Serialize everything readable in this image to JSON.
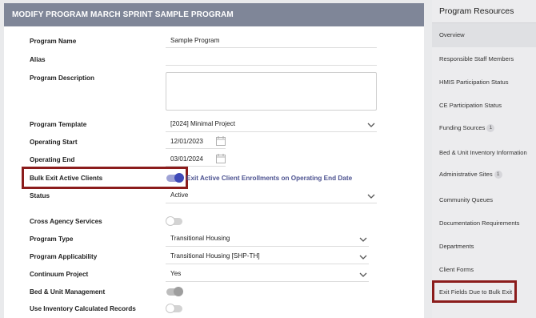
{
  "header": {
    "title": "MODIFY PROGRAM MARCH SPRINT SAMPLE PROGRAM"
  },
  "form": {
    "program_name": {
      "label": "Program Name",
      "value": "Sample Program"
    },
    "alias": {
      "label": "Alias",
      "value": ""
    },
    "program_description": {
      "label": "Program Description",
      "value": ""
    },
    "program_template": {
      "label": "Program Template",
      "value": "[2024] Minimal Project"
    },
    "operating_start": {
      "label": "Operating Start",
      "value": "12/01/2023"
    },
    "operating_end": {
      "label": "Operating End",
      "value": "03/01/2024"
    },
    "bulk_exit": {
      "label": "Bulk Exit Active Clients",
      "toggle_text": "Exit Active Client Enrollments on Operating End Date",
      "enabled": true
    },
    "status": {
      "label": "Status",
      "value": "Active"
    },
    "cross_agency": {
      "label": "Cross Agency Services",
      "enabled": false
    },
    "program_type": {
      "label": "Program Type",
      "value": "Transitional Housing"
    },
    "program_applicability": {
      "label": "Program Applicability",
      "value": "Transitional Housing [SHP-TH]"
    },
    "continuum_project": {
      "label": "Continuum Project",
      "value": "Yes"
    },
    "bed_unit_management": {
      "label": "Bed & Unit Management",
      "enabled": true
    },
    "use_inventory": {
      "label": "Use Inventory Calculated Records",
      "enabled": false
    }
  },
  "sidebar": {
    "title": "Program Resources",
    "items": [
      {
        "label": "Overview",
        "active": true
      },
      {
        "label": "Responsible Staff Members"
      },
      {
        "label": "HMIS Participation Status"
      },
      {
        "label": "CE Participation Status"
      },
      {
        "label": "Funding Sources",
        "badge": "1"
      },
      {
        "label": "Bed & Unit Inventory Information"
      },
      {
        "label": "Administrative Sites",
        "badge": "1"
      },
      {
        "label": "Community Queues"
      },
      {
        "label": "Documentation Requirements"
      },
      {
        "label": "Departments"
      },
      {
        "label": "Client Forms"
      },
      {
        "label": "Exit Fields Due to Bulk Exit"
      }
    ]
  },
  "colors": {
    "header_bg": "#7f8698",
    "highlight_border": "#8b1c1c",
    "toggle_on": "#3f4ab8",
    "toggle_text": "#4c5290"
  }
}
